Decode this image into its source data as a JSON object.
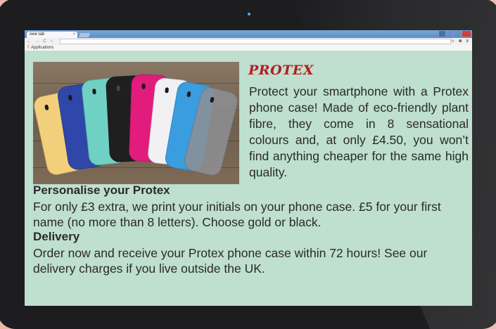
{
  "browser": {
    "tab_title": "new tab",
    "tab_close": "×",
    "bookmarks_label": "Applications",
    "nav_icons": "← → C ⌂",
    "toolbar_right": "☆ ⊗ ≡"
  },
  "product": {
    "name": "PROTEX",
    "description": "Protect your smartphone with a Protex phone case! Made of eco-friendly plant fibre, they come in 8 sensational colours and, at only £4.50, you won’t find anything cheaper for the same high quality."
  },
  "personalise": {
    "heading": "Personalise your Protex",
    "text": "For only £3 extra, we print your initials on your phone case. £5 for your first name (no more than 8 letters). Choose gold or black."
  },
  "delivery": {
    "heading": "Delivery",
    "text": "Order now and receive your Protex phone case within 72 hours! See our delivery charges if you live outside the UK."
  },
  "colors": {
    "page_bg": "#bfdfcf",
    "title_red": "#b51d1d",
    "text": "#2a2a2a",
    "backdrop": "#e8b9a8",
    "case_colors": [
      "#f2cf7a",
      "#2f47a8",
      "#6fd1c4",
      "#1f1f1f",
      "#e21c7c",
      "#f1f1f4",
      "#3a9de0",
      "#8e8f93"
    ]
  }
}
